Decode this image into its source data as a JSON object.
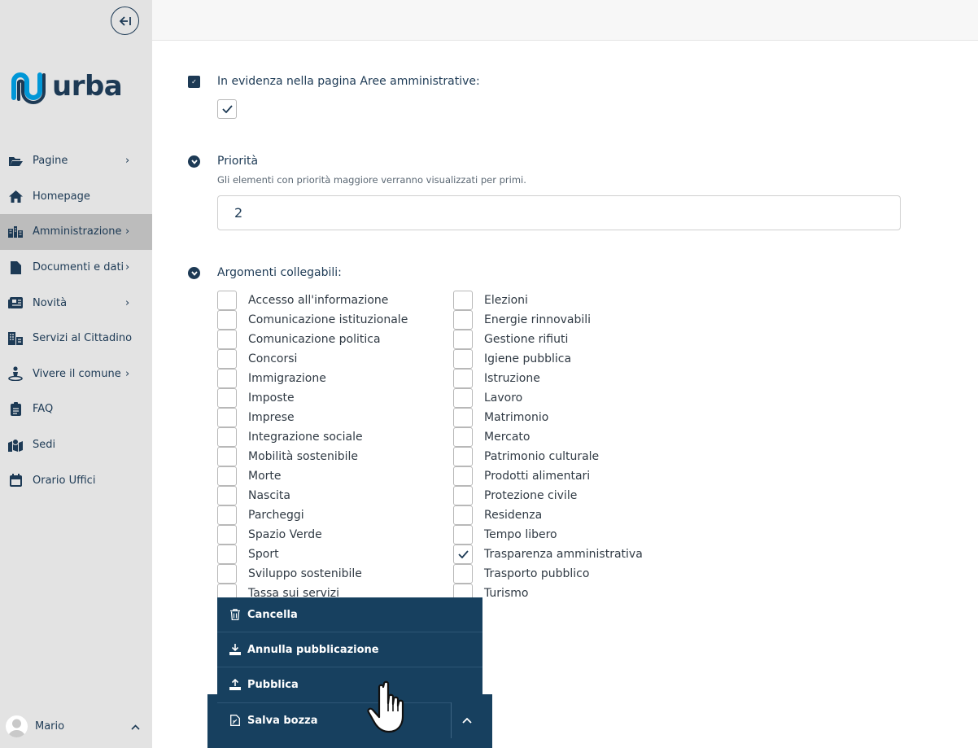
{
  "sidebar": {
    "logo_text": "urba",
    "brand_color": "#0097d7",
    "items": [
      {
        "label": "Pagine",
        "icon": "folder-open-icon",
        "chevron": true,
        "active": false
      },
      {
        "label": "Homepage",
        "icon": "home-icon",
        "chevron": false,
        "active": false
      },
      {
        "label": "Amministrazione",
        "icon": "buildings-icon",
        "chevron": true,
        "active": true
      },
      {
        "label": "Documenti e dati",
        "icon": "file-icon",
        "chevron": true,
        "active": false
      },
      {
        "label": "Novità",
        "icon": "newspaper-icon",
        "chevron": true,
        "active": false
      },
      {
        "label": "Servizi al Cittadino",
        "icon": "city-icon",
        "chevron": false,
        "active": false
      },
      {
        "label": "Vivere il comune",
        "icon": "person-pin-icon",
        "chevron": true,
        "active": false
      },
      {
        "label": "FAQ",
        "icon": "clipboard-icon",
        "chevron": false,
        "active": false
      },
      {
        "label": "Sedi",
        "icon": "map-marked-icon",
        "chevron": false,
        "active": false
      },
      {
        "label": "Orario Uffici",
        "icon": "calendar-icon",
        "chevron": false,
        "active": false
      }
    ],
    "user": {
      "name": "Mario"
    }
  },
  "main": {
    "highlight": {
      "title": "In evidenza nella pagina Aree amministrative:",
      "checked": true
    },
    "priority": {
      "title": "Priorità",
      "hint": "Gli elementi con priorità maggiore verranno visualizzati per primi.",
      "value": "2"
    },
    "topics": {
      "title": "Argomenti collegabili:",
      "left": [
        {
          "label": "Accesso all'informazione",
          "checked": false
        },
        {
          "label": "Comunicazione istituzionale",
          "checked": false
        },
        {
          "label": "Comunicazione politica",
          "checked": false
        },
        {
          "label": "Concorsi",
          "checked": false
        },
        {
          "label": "Immigrazione",
          "checked": false
        },
        {
          "label": "Imposte",
          "checked": false
        },
        {
          "label": "Imprese",
          "checked": false
        },
        {
          "label": "Integrazione sociale",
          "checked": false
        },
        {
          "label": "Mobilità sostenibile",
          "checked": false
        },
        {
          "label": "Morte",
          "checked": false
        },
        {
          "label": "Nascita",
          "checked": false
        },
        {
          "label": "Parcheggi",
          "checked": false
        },
        {
          "label": "Spazio Verde",
          "checked": false
        },
        {
          "label": "Sport",
          "checked": false
        },
        {
          "label": "Sviluppo sostenibile",
          "checked": false
        },
        {
          "label": "Tassa sui servizi",
          "checked": false
        }
      ],
      "right": [
        {
          "label": "Elezioni",
          "checked": false
        },
        {
          "label": "Energie rinnovabili",
          "checked": false
        },
        {
          "label": "Gestione rifiuti",
          "checked": false
        },
        {
          "label": "Igiene pubblica",
          "checked": false
        },
        {
          "label": "Istruzione",
          "checked": false
        },
        {
          "label": "Lavoro",
          "checked": false
        },
        {
          "label": "Matrimonio",
          "checked": false
        },
        {
          "label": "Mercato",
          "checked": false
        },
        {
          "label": "Patrimonio culturale",
          "checked": false
        },
        {
          "label": "Prodotti alimentari",
          "checked": false
        },
        {
          "label": "Protezione civile",
          "checked": false
        },
        {
          "label": "Residenza",
          "checked": false
        },
        {
          "label": "Tempo libero",
          "checked": false
        },
        {
          "label": "Trasparenza amministrativa",
          "checked": true
        },
        {
          "label": "Trasporto pubblico",
          "checked": false
        },
        {
          "label": "Turismo",
          "checked": false
        }
      ]
    }
  },
  "actions": {
    "menu": [
      {
        "label": "Cancella",
        "icon": "trash-icon"
      },
      {
        "label": "Annulla pubblicazione",
        "icon": "download-icon"
      },
      {
        "label": "Pubblica",
        "icon": "upload-icon"
      }
    ],
    "save_label": "Salva bozza",
    "save_icon": "file-pen-icon"
  },
  "colors": {
    "primary": "#1d3a55",
    "action_bg": "#17405f",
    "sidebar_bg": "#e3e3e3",
    "active_bg": "#bcbcbc"
  }
}
